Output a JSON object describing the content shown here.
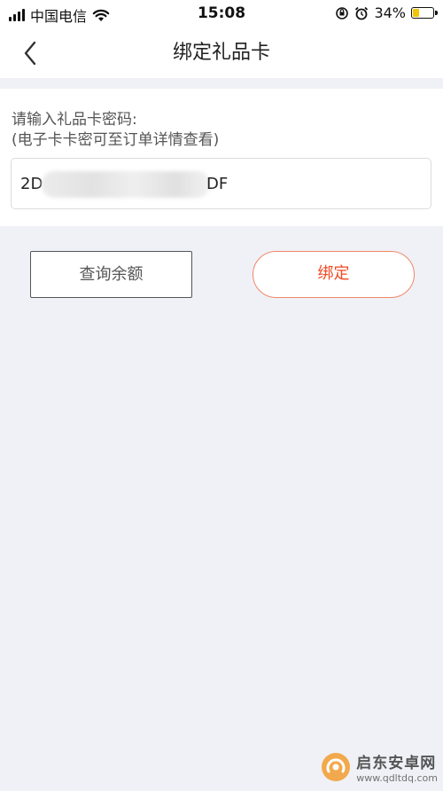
{
  "status_bar": {
    "carrier": "中国电信",
    "time": "15:08",
    "battery_percent": "34%",
    "battery_level": 0.34,
    "icons": [
      "signal-icon",
      "wifi-icon",
      "orientation-lock-icon",
      "alarm-icon",
      "battery-icon"
    ]
  },
  "nav": {
    "back_icon": "chevron-left-icon",
    "title": "绑定礼品卡"
  },
  "form": {
    "label_line1": "请输入礼品卡密码:",
    "label_line2": "(电子卡卡密可至订单详情查看)",
    "code_prefix": "2D",
    "code_suffix": "DF"
  },
  "buttons": {
    "check_balance": "查询余额",
    "bind": "绑定"
  },
  "colors": {
    "accent": "#f04a25",
    "accent_border": "#f0876a",
    "page_background": "#f0f1f6",
    "battery": "#f4c400"
  },
  "watermark": {
    "title": "启东安卓网",
    "url": "www.qdltdq.com"
  }
}
